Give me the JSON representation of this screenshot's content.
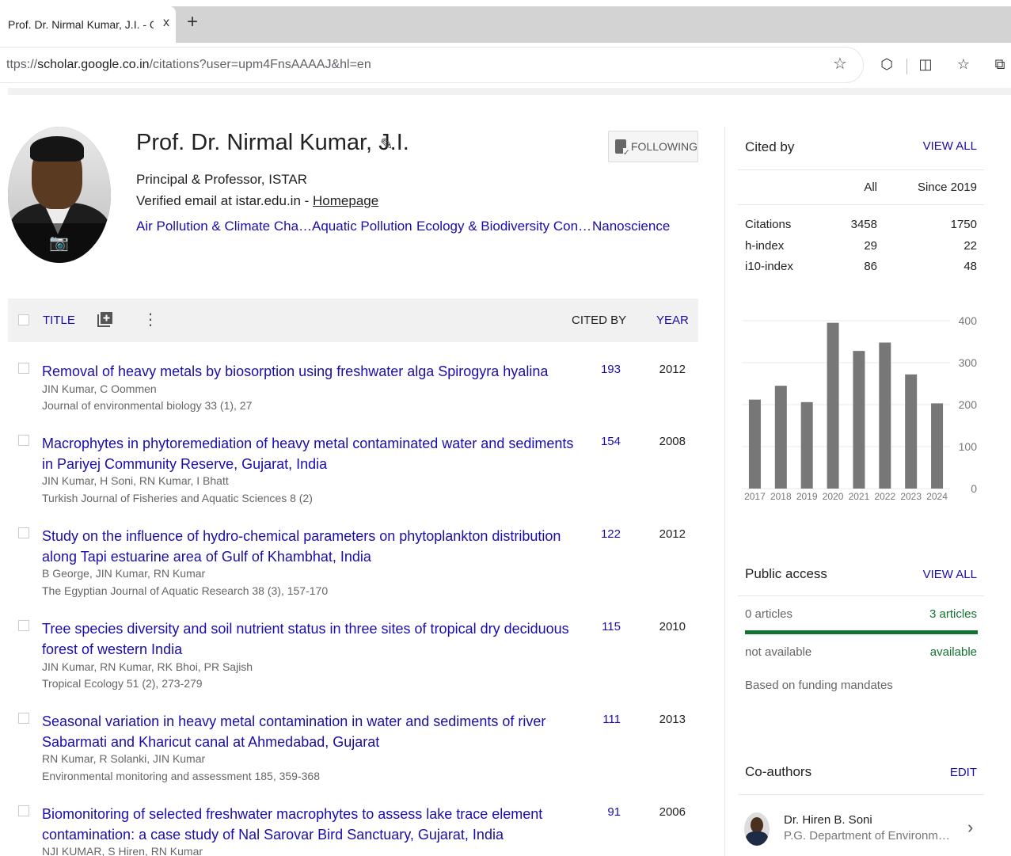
{
  "browser": {
    "tab_title": "Prof. Dr. Nirmal Kumar, J.I. - Goog",
    "tab_close": "x",
    "new_tab": "+",
    "url_prefix": "ttps://",
    "url_host": "scholar.google.co.in",
    "url_path": "/citations?user=upm4FnsAAAAJ&hl=en"
  },
  "profile": {
    "name": "Prof. Dr. Nirmal Kumar, J.I.",
    "affiliation": "Principal & Professor, ISTAR",
    "email_text": "Verified email at istar.edu.in - ",
    "homepage_link": "Homepage",
    "follow_label": "FOLLOWING",
    "interests": [
      "Air Pollution & Climate Cha…",
      "Aquatic Pollution",
      "Ecology & Biodiversity Con…",
      "Nanoscience"
    ]
  },
  "table": {
    "title_header": "TITLE",
    "cited_header": "CITED BY",
    "year_header": "YEAR",
    "rows": [
      {
        "title": "Removal of heavy metals by biosorption using freshwater alga Spirogyra hyalina",
        "authors": "JIN Kumar, C Oommen",
        "venue": "Journal of environmental biology 33 (1), 27",
        "cited_by": "193",
        "year": "2012"
      },
      {
        "title": "Macrophytes in phytoremediation of heavy metal contaminated water and sediments in Pariyej Community Reserve, Gujarat, India",
        "authors": "JIN Kumar, H Soni, RN Kumar, I Bhatt",
        "venue": "Turkish Journal of Fisheries and Aquatic Sciences 8 (2)",
        "cited_by": "154",
        "year": "2008"
      },
      {
        "title": "Study on the influence of hydro-chemical parameters on phytoplankton distribution along Tapi estuarine area of Gulf of Khambhat, India",
        "authors": "B George, JIN Kumar, RN Kumar",
        "venue": "The Egyptian Journal of Aquatic Research 38 (3), 157-170",
        "cited_by": "122",
        "year": "2012"
      },
      {
        "title": "Tree species diversity and soil nutrient status in three sites of tropical dry deciduous forest of western India",
        "authors": "JIN Kumar, RN Kumar, RK Bhoi, PR Sajish",
        "venue": "Tropical Ecology 51 (2), 273-279",
        "cited_by": "115",
        "year": "2010"
      },
      {
        "title": "Seasonal variation in heavy metal contamination in water and sediments of river Sabarmati and Kharicut canal at Ahmedabad, Gujarat",
        "authors": "RN Kumar, R Solanki, JIN Kumar",
        "venue": "Environmental monitoring and assessment 185, 359-368",
        "cited_by": "111",
        "year": "2013"
      },
      {
        "title": "Biomonitoring of selected freshwater macrophytes to assess lake trace element contamination: a case study of Nal Sarovar Bird Sanctuary, Gujarat, India",
        "authors": "NJI KUMAR, S Hiren, RN Kumar",
        "venue": "",
        "cited_by": "91",
        "year": "2006"
      }
    ]
  },
  "cited_by": {
    "heading": "Cited by",
    "view_all": "VIEW ALL",
    "col_all": "All",
    "col_since": "Since 2019",
    "stats": [
      {
        "label": "Citations",
        "all": "3458",
        "since": "1750"
      },
      {
        "label": "h-index",
        "all": "29",
        "since": "22"
      },
      {
        "label": "i10-index",
        "all": "86",
        "since": "48"
      }
    ]
  },
  "chart_data": {
    "type": "bar",
    "categories": [
      "2017",
      "2018",
      "2019",
      "2020",
      "2021",
      "2022",
      "2023",
      "2024"
    ],
    "values": [
      212,
      245,
      206,
      395,
      328,
      348,
      272,
      203
    ],
    "yticks": [
      0,
      100,
      200,
      300,
      400
    ],
    "ylim": [
      0,
      400
    ],
    "bar_color": "#777777"
  },
  "public_access": {
    "heading": "Public access",
    "view_all": "VIEW ALL",
    "left_count": "0 articles",
    "right_count": "3 articles",
    "left_status": "not available",
    "right_status": "available",
    "available_fraction": 1.0,
    "note": "Based on funding mandates"
  },
  "coauthors": {
    "heading": "Co-authors",
    "edit": "EDIT",
    "items": [
      {
        "name": "Dr. Hiren B. Soni",
        "affiliation": "P.G. Department of Environment…"
      }
    ]
  }
}
